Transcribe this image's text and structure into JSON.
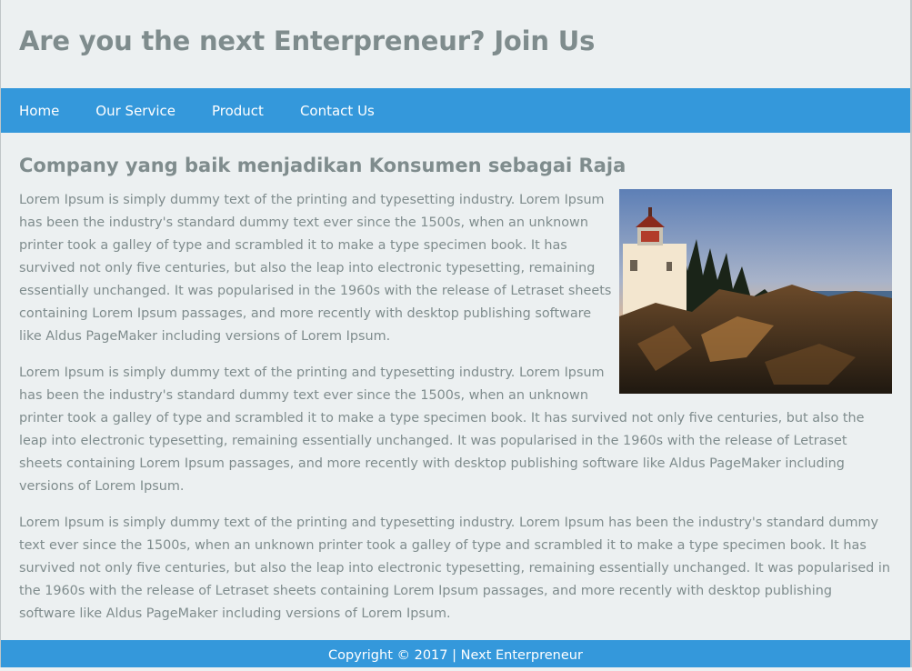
{
  "header": {
    "title": "Are you the next Enterpreneur? Join Us"
  },
  "nav": {
    "items": [
      {
        "label": "Home"
      },
      {
        "label": "Our Service"
      },
      {
        "label": "Product"
      },
      {
        "label": "Contact Us"
      }
    ]
  },
  "main": {
    "title": "Company yang baik menjadikan Konsumen sebagai Raja",
    "image_icon": "lighthouse-photo",
    "paragraphs": [
      "Lorem Ipsum is simply dummy text of the printing and typesetting industry. Lorem Ipsum has been the industry's standard dummy text ever since the 1500s, when an unknown printer took a galley of type and scrambled it to make a type specimen book. It has survived not only five centuries, but also the leap into electronic typesetting, remaining essentially unchanged. It was popularised in the 1960s with the release of Letraset sheets containing Lorem Ipsum passages, and more recently with desktop publishing software like Aldus PageMaker including versions of Lorem Ipsum.",
      "Lorem Ipsum is simply dummy text of the printing and typesetting industry. Lorem Ipsum has been the industry's standard dummy text ever since the 1500s, when an unknown printer took a galley of type and scrambled it to make a type specimen book. It has survived not only five centuries, but also the leap into electronic typesetting, remaining essentially unchanged. It was popularised in the 1960s with the release of Letraset sheets containing Lorem Ipsum passages, and more recently with desktop publishing software like Aldus PageMaker including versions of Lorem Ipsum.",
      "Lorem Ipsum is simply dummy text of the printing and typesetting industry. Lorem Ipsum has been the industry's standard dummy text ever since the 1500s, when an unknown printer took a galley of type and scrambled it to make a type specimen book. It has survived not only five centuries, but also the leap into electronic typesetting, remaining essentially unchanged. It was popularised in the 1960s with the release of Letraset sheets containing Lorem Ipsum passages, and more recently with desktop publishing software like Aldus PageMaker including versions of Lorem Ipsum."
    ]
  },
  "footer": {
    "text": "Copyright © 2017 | Next Enterpreneur"
  },
  "colors": {
    "accent": "#3498db",
    "text": "#7f8c8d",
    "background": "#ecf0f1"
  }
}
